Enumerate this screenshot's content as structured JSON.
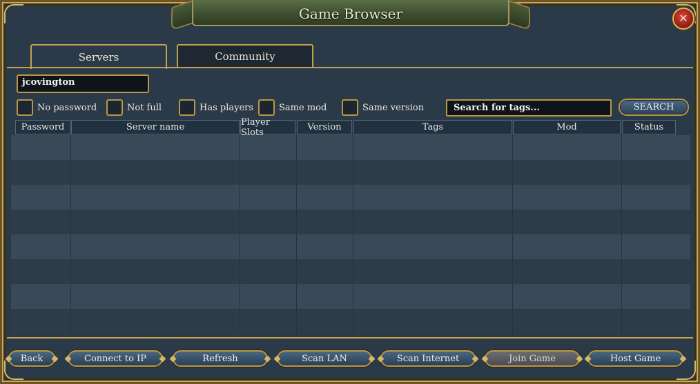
{
  "window": {
    "title": "Game Browser",
    "close_icon": "close-icon"
  },
  "tabs": [
    {
      "label": "Servers",
      "active": true
    },
    {
      "label": "Community",
      "active": false
    }
  ],
  "player_name": {
    "value": "jcovington"
  },
  "filters": [
    {
      "label": "No password",
      "checked": false
    },
    {
      "label": "Not full",
      "checked": false
    },
    {
      "label": "Has players",
      "checked": false
    },
    {
      "label": "Same mod",
      "checked": false
    },
    {
      "label": "Same version",
      "checked": false
    }
  ],
  "tag_search": {
    "placeholder": "Search for tags..."
  },
  "search_button": {
    "label": "SEARCH"
  },
  "table": {
    "columns": [
      "Password",
      "Server name",
      "Player Slots",
      "Version",
      "Tags",
      "Mod",
      "Status"
    ],
    "rows": []
  },
  "buttons": [
    {
      "label": "Back",
      "enabled": true
    },
    {
      "label": "Connect to IP",
      "enabled": true
    },
    {
      "label": "Refresh",
      "enabled": true
    },
    {
      "label": "Scan LAN",
      "enabled": true
    },
    {
      "label": "Scan Internet",
      "enabled": true
    },
    {
      "label": "Join Game",
      "enabled": false
    },
    {
      "label": "Host Game",
      "enabled": true
    }
  ],
  "colors": {
    "panel": "#2b3a49",
    "gold_trim": "#c5a24f",
    "button": "#3a546d",
    "close": "#b8352a"
  }
}
